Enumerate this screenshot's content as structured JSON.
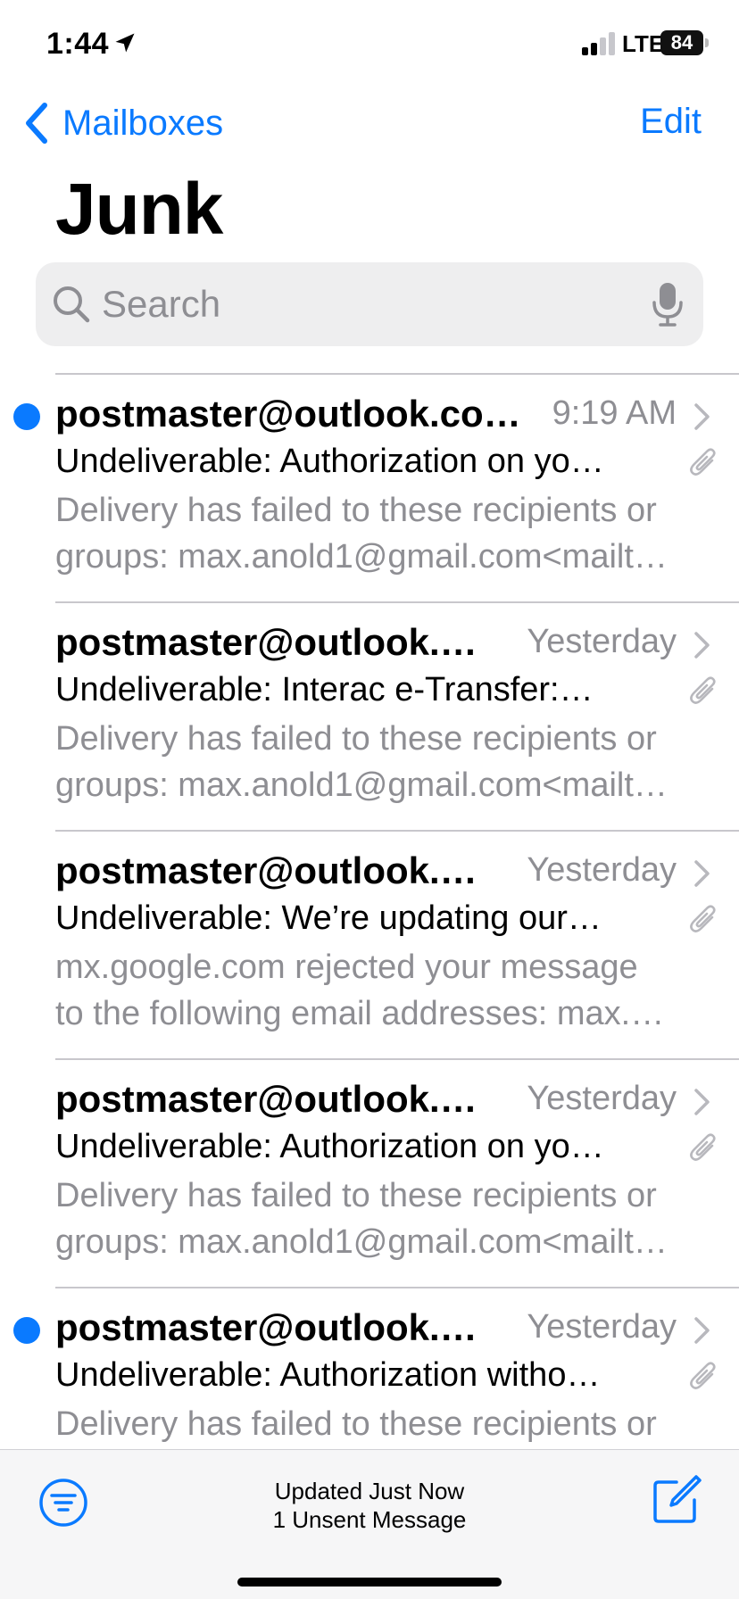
{
  "status_bar": {
    "time": "1:44",
    "network": "LTE",
    "battery": "84"
  },
  "nav": {
    "back_label": "Mailboxes",
    "edit_label": "Edit"
  },
  "title": "Junk",
  "search": {
    "placeholder": "Search",
    "value": ""
  },
  "emails": [
    {
      "unread": true,
      "sender": "postmaster@outlook.co…",
      "time": "9:19 AM",
      "subject": "Undeliverable: Authorization on yo…",
      "preview_line1": "Delivery has failed to these recipients or",
      "preview_line2": "groups: max.anold1@gmail.com<mailt…",
      "has_attachment": true
    },
    {
      "unread": false,
      "sender": "postmaster@outlook.…",
      "time": "Yesterday",
      "subject": "Undeliverable: Interac e-Transfer:…",
      "preview_line1": "Delivery has failed to these recipients or",
      "preview_line2": "groups: max.anold1@gmail.com<mailt…",
      "has_attachment": true
    },
    {
      "unread": false,
      "sender": "postmaster@outlook.…",
      "time": "Yesterday",
      "subject": "Undeliverable: We’re updating our…",
      "preview_line1": "mx.google.com rejected your message",
      "preview_line2": "to the following email addresses: max.…",
      "has_attachment": true
    },
    {
      "unread": false,
      "sender": "postmaster@outlook.…",
      "time": "Yesterday",
      "subject": "Undeliverable: Authorization on yo…",
      "preview_line1": "Delivery has failed to these recipients or",
      "preview_line2": "groups: max.anold1@gmail.com<mailt…",
      "has_attachment": true
    },
    {
      "unread": true,
      "sender": "postmaster@outlook.…",
      "time": "Yesterday",
      "subject": "Undeliverable: Authorization witho…",
      "preview_line1": "Delivery has failed to these recipients or",
      "preview_line2": "",
      "has_attachment": true
    }
  ],
  "toolbar": {
    "status_line1": "Updated Just Now",
    "status_line2": "1 Unsent Message"
  },
  "colors": {
    "accent": "#0a7aff",
    "secondary_text": "#8e8e93"
  },
  "icons": {
    "location": "location-arrow-icon",
    "signal": "cellular-signal-icon",
    "battery": "battery-icon",
    "back": "chevron-left-icon",
    "search": "search-icon",
    "mic": "microphone-icon",
    "chevron": "chevron-right-icon",
    "attachment": "paperclip-icon",
    "filter": "filter-icon",
    "compose": "compose-icon"
  }
}
